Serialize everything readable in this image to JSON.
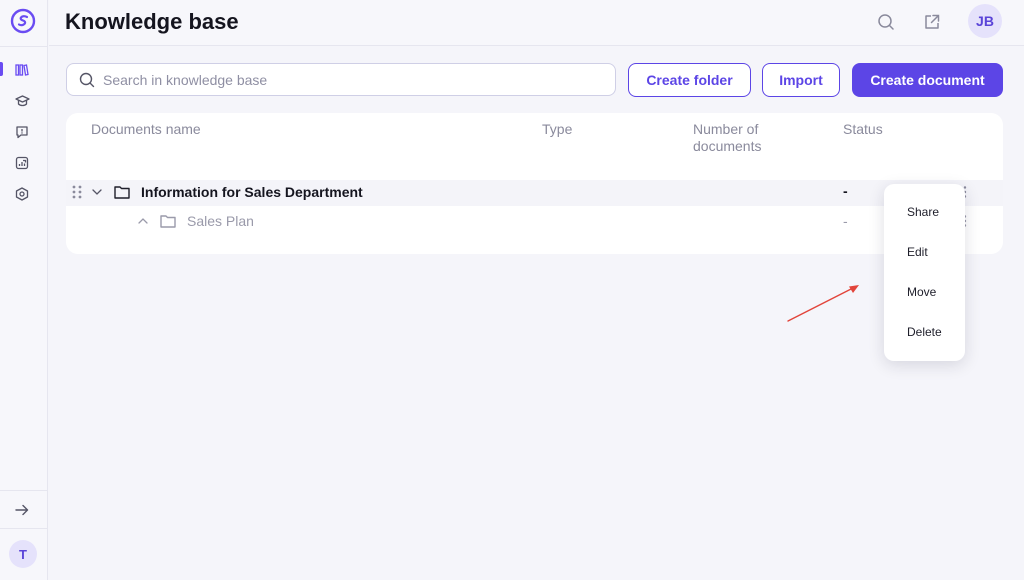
{
  "sidebar": {
    "logo": "app-logo-icon",
    "items": [
      {
        "name": "knowledge-base-icon",
        "active": true
      },
      {
        "name": "learning-cap-icon",
        "active": false
      },
      {
        "name": "feedback-chat-icon",
        "active": false
      },
      {
        "name": "analytics-icon",
        "active": false
      },
      {
        "name": "settings-hex-icon",
        "active": false
      }
    ],
    "expand_icon": "arrow-right-icon",
    "user_initial": "T"
  },
  "header": {
    "title": "Knowledge base",
    "search_icon": "search-icon",
    "external_icon": "external-link-icon",
    "user_initials": "JB"
  },
  "toolbar": {
    "search_placeholder": "Search in knowledge base",
    "create_folder": "Create folder",
    "import": "Import",
    "create_document": "Create document"
  },
  "table": {
    "columns": [
      "Documents name",
      "Type",
      "Number of documents",
      "Status"
    ],
    "rows": [
      {
        "name": "Information for Sales Department",
        "type": "",
        "count": "",
        "status": "-",
        "expanded": true
      },
      {
        "name": "Sales Plan",
        "type": "",
        "count": "",
        "status": "-",
        "child": true
      }
    ]
  },
  "context_menu": {
    "items": [
      "Share",
      "Edit",
      "Move",
      "Delete"
    ]
  },
  "colors": {
    "accent": "#5c45e6",
    "arrow": "#e2443a"
  }
}
